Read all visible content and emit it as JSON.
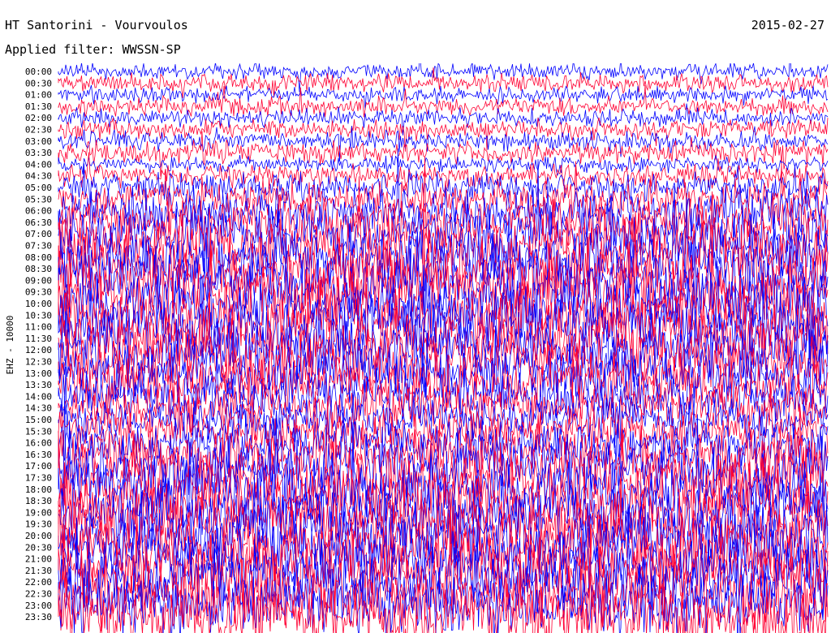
{
  "header": {
    "title": "HT Santorini - Vourvoulos",
    "filter": "Applied filter: WWSSN-SP",
    "date": "2015-02-27"
  },
  "chart_data": {
    "type": "helicorder",
    "title": "HT Santorini - Vourvoulos",
    "subtitle": "Applied filter: WWSSN-SP",
    "date": "2015-02-27",
    "ylabel": "EHZ - 10000",
    "xlabel": "",
    "grid": false,
    "series": [
      {
        "color": "#0000ff"
      },
      {
        "color": "#ff0033"
      }
    ],
    "trace_colors": [
      "#0000ff",
      "#ff0033"
    ],
    "row_times": [
      "00:00",
      "00:30",
      "01:00",
      "01:30",
      "02:00",
      "02:30",
      "03:00",
      "03:30",
      "04:00",
      "04:30",
      "05:00",
      "05:30",
      "06:00",
      "06:30",
      "07:00",
      "07:30",
      "08:00",
      "08:30",
      "09:00",
      "09:30",
      "10:00",
      "10:30",
      "11:00",
      "11:30",
      "12:00",
      "12:30",
      "13:00",
      "13:30",
      "14:00",
      "14:30",
      "15:00",
      "15:30",
      "16:00",
      "16:30",
      "17:00",
      "17:30",
      "18:00",
      "18:30",
      "19:00",
      "19:30",
      "20:00",
      "20:30",
      "21:00",
      "21:30",
      "22:00",
      "22:30",
      "23:00",
      "23:30"
    ],
    "row_noise_level": [
      0.15,
      0.18,
      0.15,
      0.2,
      0.18,
      0.22,
      0.2,
      0.25,
      0.15,
      0.25,
      0.35,
      0.45,
      0.6,
      0.7,
      0.75,
      0.8,
      0.8,
      0.85,
      0.85,
      0.9,
      0.9,
      0.9,
      0.9,
      0.85,
      0.85,
      0.8,
      0.75,
      0.7,
      0.65,
      0.6,
      0.55,
      0.55,
      0.6,
      0.7,
      0.8,
      0.85,
      0.9,
      0.9,
      0.9,
      0.9,
      0.9,
      0.9,
      0.9,
      0.9,
      0.95,
      0.95,
      0.95,
      0.95
    ]
  }
}
